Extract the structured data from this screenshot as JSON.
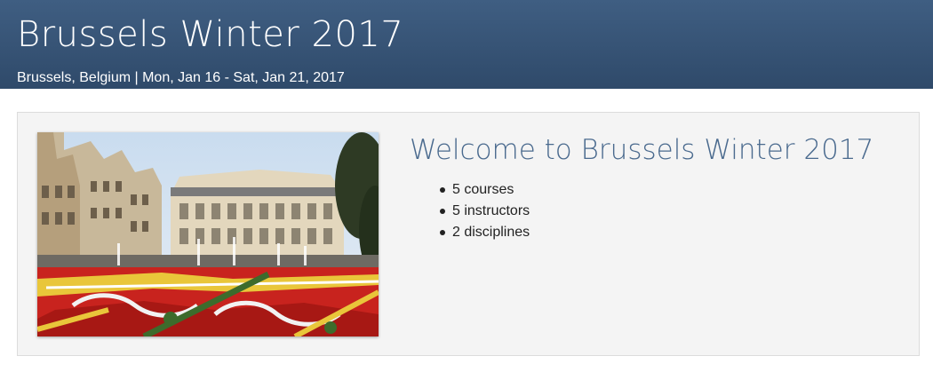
{
  "header": {
    "title": "Brussels Winter 2017",
    "subtitle": "Brussels, Belgium | Mon, Jan 16 - Sat, Jan 21, 2017"
  },
  "main": {
    "photo_name": "brussels-grand-place-flower-carpet-photo",
    "welcome_title": "Welcome to Brussels Winter 2017",
    "stats": [
      {
        "label": "5 courses"
      },
      {
        "label": "5 instructors"
      },
      {
        "label": "2 disciplines"
      }
    ]
  },
  "colors": {
    "header_bg": "#34506f",
    "accent_title": "#4a6a8e",
    "panel_bg": "#f4f4f4"
  }
}
